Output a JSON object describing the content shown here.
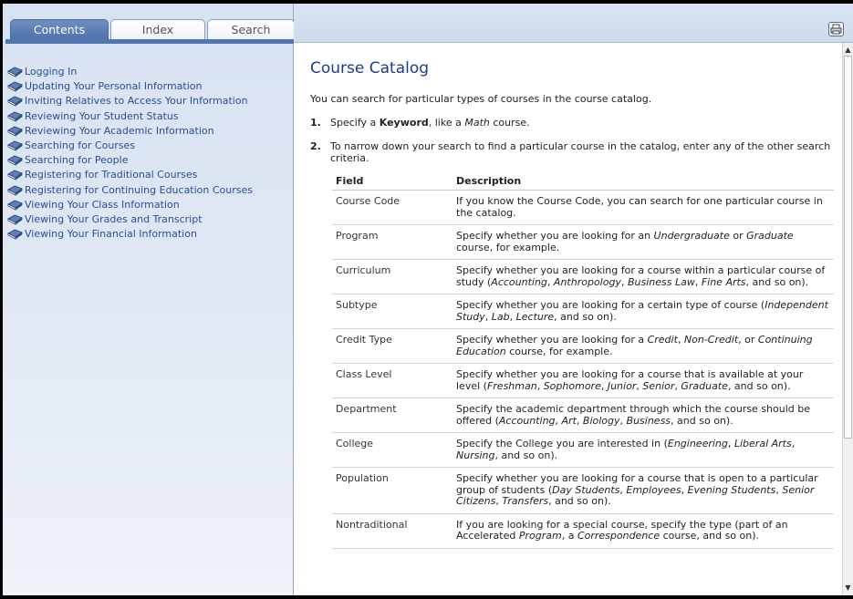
{
  "tabs": {
    "contents": "Contents",
    "index": "Index",
    "search": "Search"
  },
  "toc": [
    "Logging In",
    "Updating Your Personal Information",
    "Inviting Relatives to Access Your Information",
    "Reviewing Your Student Status",
    "Reviewing Your Academic Information",
    "Searching for Courses",
    "Searching for People",
    "Registering for Traditional Courses",
    "Registering for Continuing Education Courses",
    "Viewing Your Class Information",
    "Viewing Your Grades and Transcript",
    "Viewing Your Financial Information"
  ],
  "icons": {
    "toc_item": "book-icon",
    "print": "print-icon"
  },
  "colors": {
    "accent": "#5476b0",
    "link": "#2a4c9a",
    "title": "#1c3d8c"
  },
  "page": {
    "title": "Course Catalog",
    "intro": "You can search for particular types of courses in the course catalog.",
    "step1": {
      "num": "1.",
      "pre": "Specify a ",
      "bold": "Keyword",
      "mid": ", like a ",
      "ital": "Math",
      "post": " course."
    },
    "step2": {
      "num": "2.",
      "text": "To narrow down your search to find a particular course in the catalog, enter any of the other search criteria."
    }
  },
  "table": {
    "headers": {
      "field": "Field",
      "description": "Description"
    },
    "rows": [
      {
        "field": "Course Code",
        "desc": "If you know the Course Code, you can search for one particular course in the catalog."
      },
      {
        "field": "Program",
        "desc": "Specify whether you are looking for an <em>Undergraduate</em> or <em>Graduate</em> course, for example."
      },
      {
        "field": "Curriculum",
        "desc": "Specify whether you are looking for a course within a particular course of study (<em>Accounting</em>, <em>Anthropology</em>, <em>Business Law</em>, <em>Fine Arts</em>, and so on)."
      },
      {
        "field": "Subtype",
        "desc": "Specify whether you are looking for a certain type of course (<em>Independent Study</em>, <em>Lab</em>, <em>Lecture</em>, and so on)."
      },
      {
        "field": "Credit Type",
        "desc": "Specify whether you are looking for a <em>Credit</em>, <em>Non-Credit</em>, or <em>Continuing Education</em> course, for example."
      },
      {
        "field": "Class Level",
        "desc": "Specify whether you are looking for a course that is available at your level (<em>Freshman</em>, <em>Sophomore</em>, <em>Junior</em>, <em>Senior</em>, <em>Graduate</em>, and so on)."
      },
      {
        "field": "Department",
        "desc": "Specify the academic department through which the course should be offered (<em>Accounting</em>, <em>Art</em>, <em>Biology</em>, <em>Business</em>, and so on)."
      },
      {
        "field": "College",
        "desc": "Specify the College you are interested in (<em>Engineering</em>, <em>Liberal Arts</em>, <em>Nursing</em>, and so on)."
      },
      {
        "field": "Population",
        "desc": "Specify whether you are looking for a course that is open to a particular group of students (<em>Day Students</em>, <em>Employees</em>, <em>Evening Students</em>, <em>Senior Citizens</em>, <em>Transfers</em>, and so on)."
      },
      {
        "field": "Nontraditional",
        "desc": "If you are looking for a special course, specify the type (part of an Accelerated <em>Program</em>, a <em>Correspondence</em> course, and so on)."
      }
    ]
  }
}
